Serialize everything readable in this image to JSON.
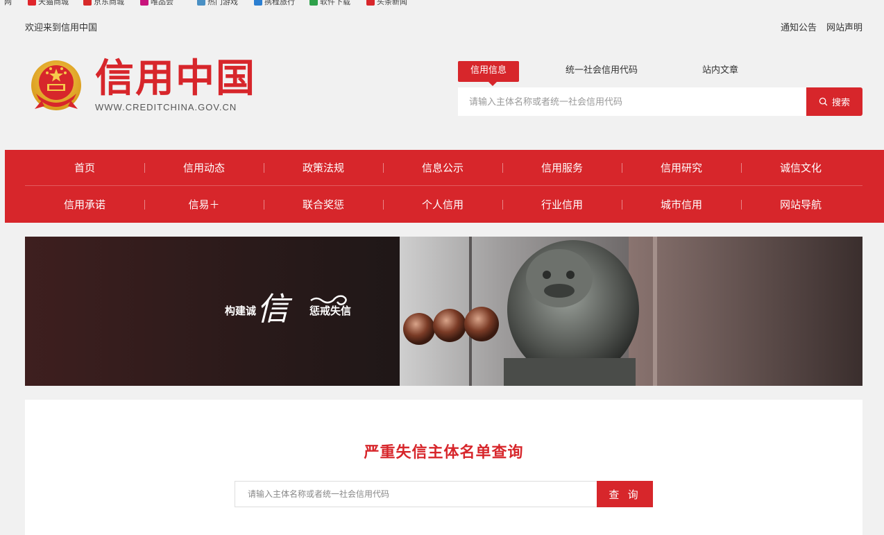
{
  "bookmarks": [
    {
      "label": "网",
      "color": "#f1f1f1"
    },
    {
      "label": "天猫商城",
      "color": "#e0262b"
    },
    {
      "label": "京东商城",
      "color": "#d72a2a"
    },
    {
      "label": "唯品会",
      "color": "#c8137c"
    },
    {
      "label": "热门游戏",
      "color": "#4a90c4"
    },
    {
      "label": "携程旅行",
      "color": "#2c7fd1"
    },
    {
      "label": "软件下载",
      "color": "#2fa14a"
    },
    {
      "label": "头条新闻",
      "color": "#d8262b"
    }
  ],
  "top": {
    "welcome": "欢迎来到信用中国",
    "links": [
      "通知公告",
      "网站声明"
    ]
  },
  "logo": {
    "title": "信用中国",
    "url": "WWW.CREDITCHINA.GOV.CN"
  },
  "search": {
    "tabs": [
      "信用信息",
      "统一社会信用代码",
      "站内文章"
    ],
    "active_tab": "信用信息",
    "placeholder": "请输入主体名称或者统一社会信用代码",
    "button_label": "搜索",
    "button_icon": "search-icon"
  },
  "nav": {
    "row1": [
      "首页",
      "信用动态",
      "政策法规",
      "信息公示",
      "信用服务",
      "信用研究",
      "诚信文化"
    ],
    "row2": [
      "信用承诺",
      "信易＋",
      "联合奖惩",
      "个人信用",
      "行业信用",
      "城市信用",
      "网站导航"
    ]
  },
  "banner": {
    "slogan_left": "构建诚",
    "slogan_char": "信",
    "slogan_right": "惩戒失信"
  },
  "query": {
    "title": "严重失信主体名单查询",
    "placeholder": "请输入主体名称或者统一社会信用代码",
    "button_label": "查 询"
  },
  "colors": {
    "brand_red": "#d7262b",
    "page_bg": "#f1f1f1"
  }
}
